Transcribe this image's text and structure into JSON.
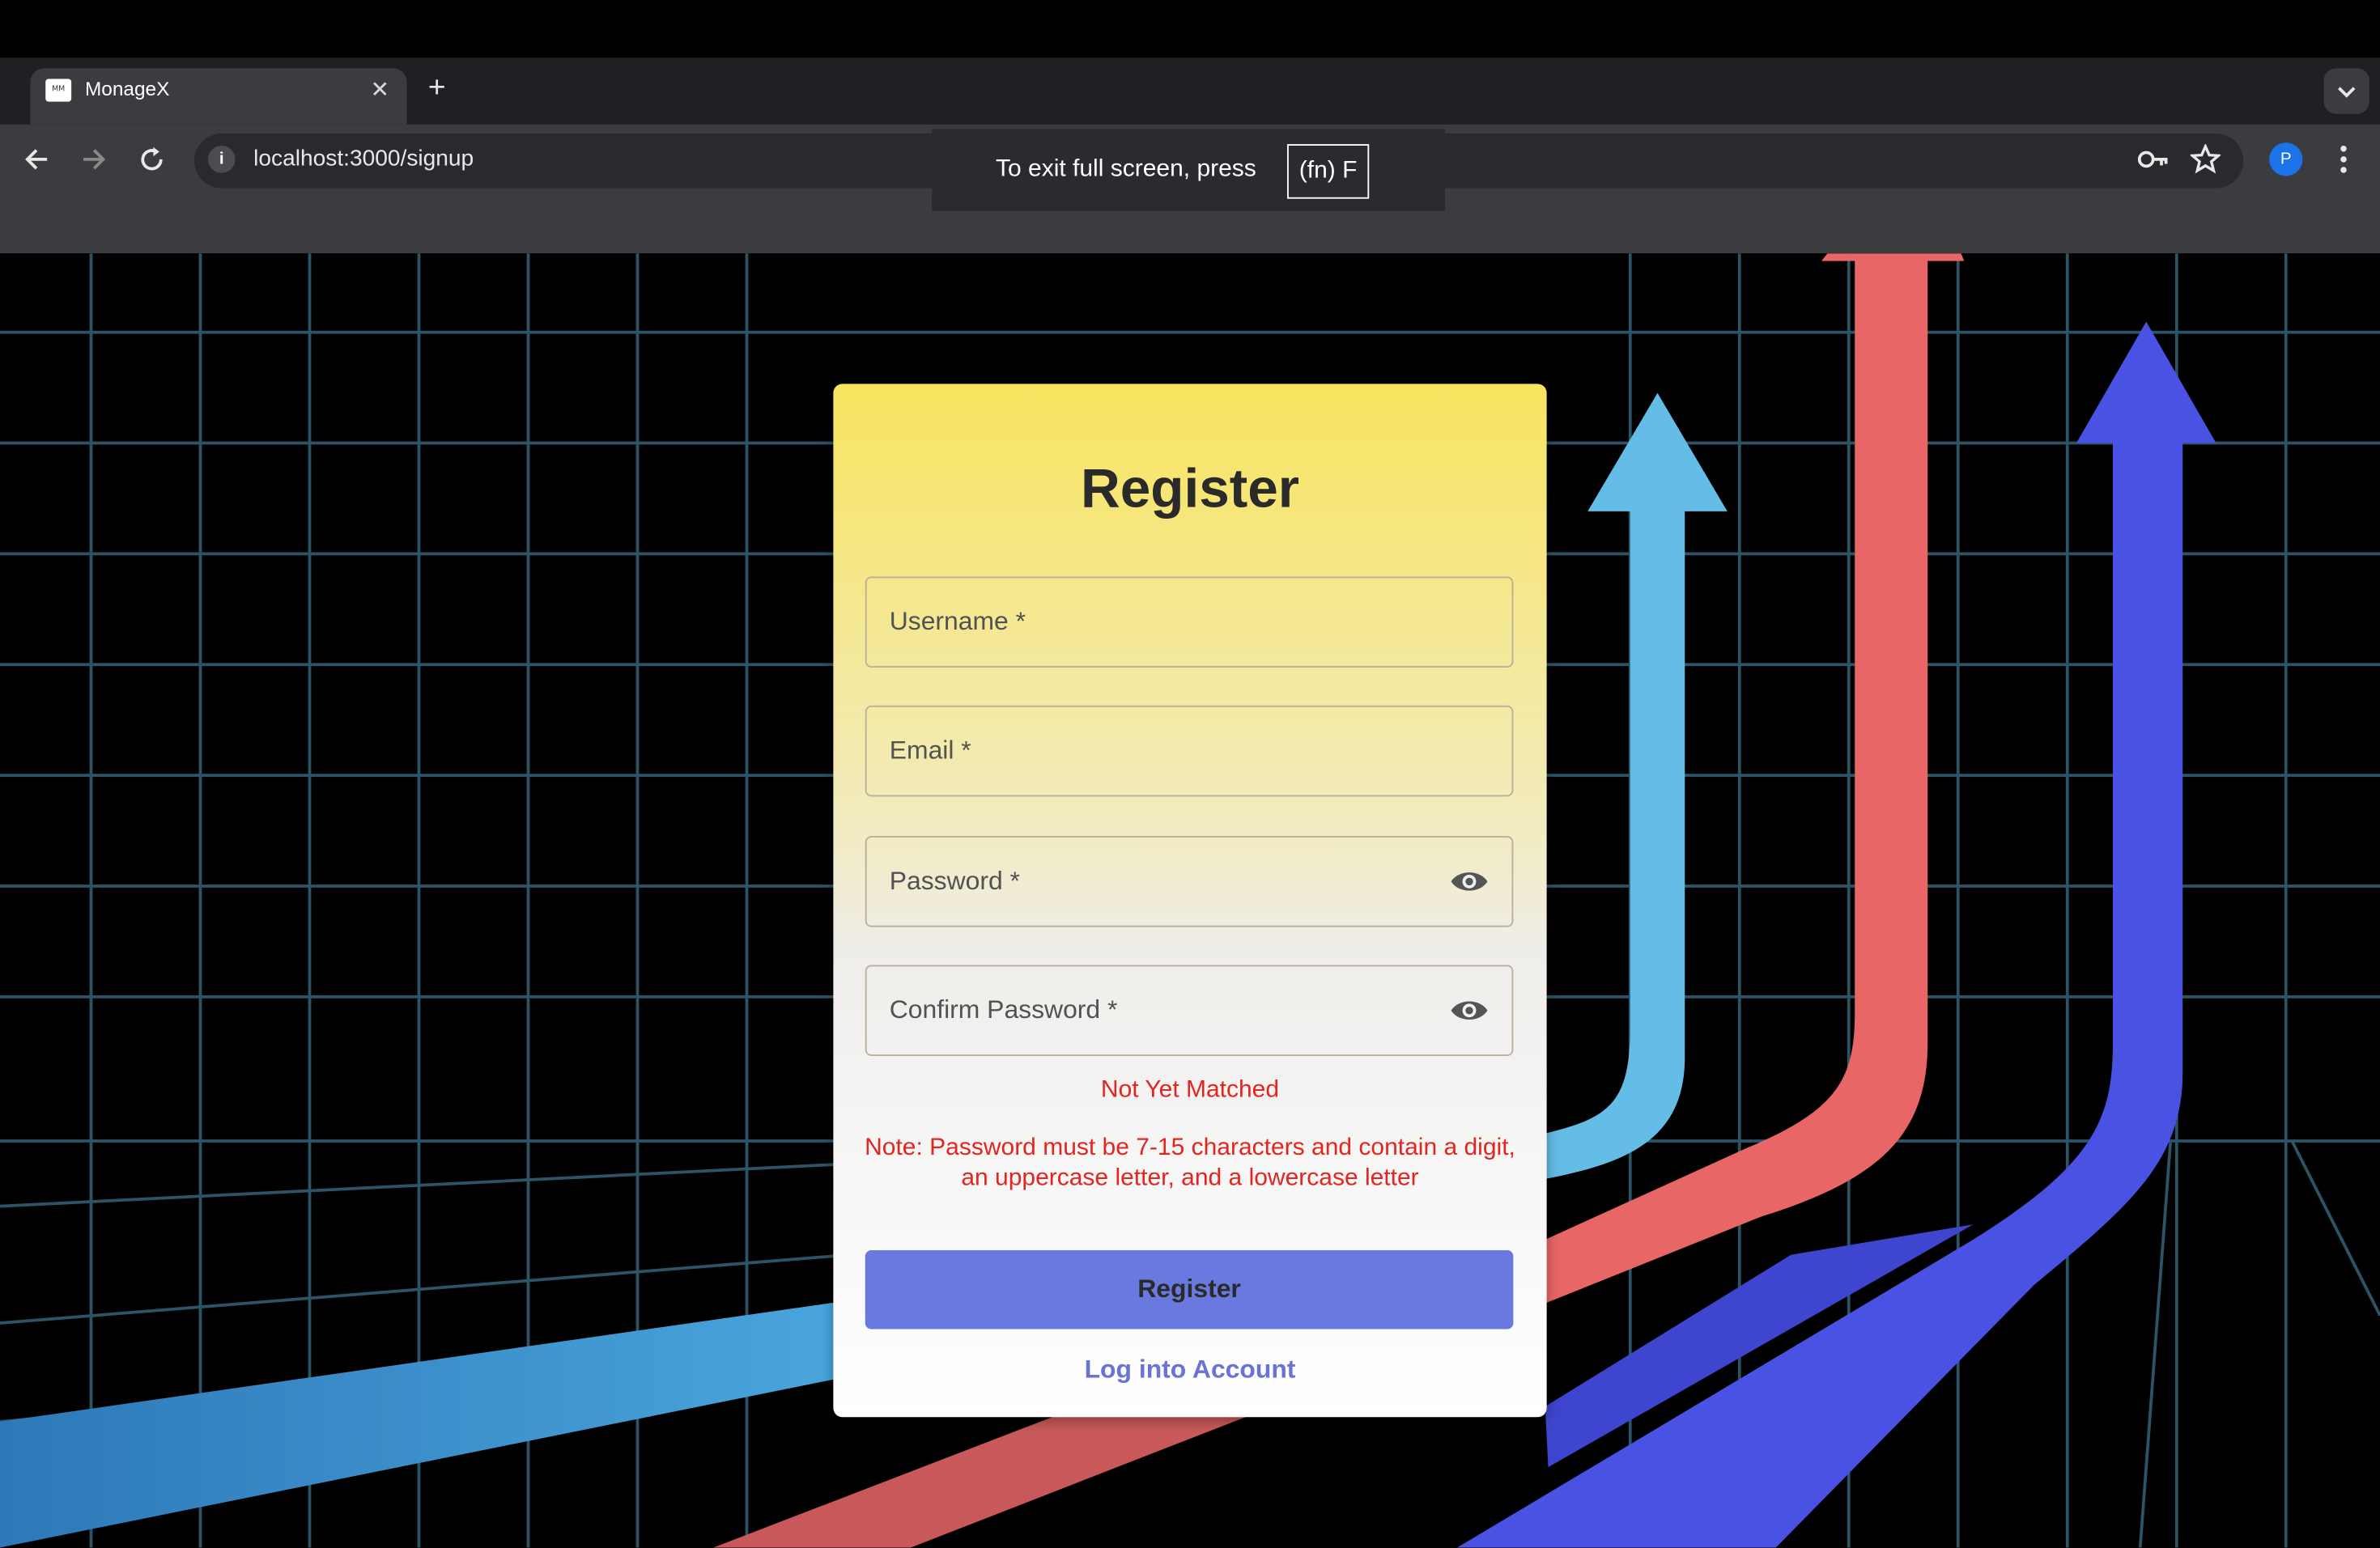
{
  "browser": {
    "tab_title": "MonageX",
    "favicon_text": "MM",
    "tab_close": "✕",
    "new_tab": "+",
    "url": "localhost:3000/signup",
    "info_icon": "i",
    "fullscreen_notice": "To exit full screen, press",
    "fullscreen_key": "(fn) F",
    "profile_initial": "P"
  },
  "form": {
    "title": "Register",
    "username_label": "Username *",
    "email_label": "Email *",
    "password_label": "Password *",
    "confirm_password_label": "Confirm Password *",
    "match_status": "Not Yet Matched",
    "password_note": "Note: Password must be 7-15 characters and contain a digit, an uppercase letter, and a lowercase letter",
    "register_button": "Register",
    "login_link": "Log into Account"
  },
  "colors": {
    "error": "#e4251f",
    "button": "#6a79e0",
    "link": "#6a72d5",
    "card_top": "#f8e45f"
  }
}
